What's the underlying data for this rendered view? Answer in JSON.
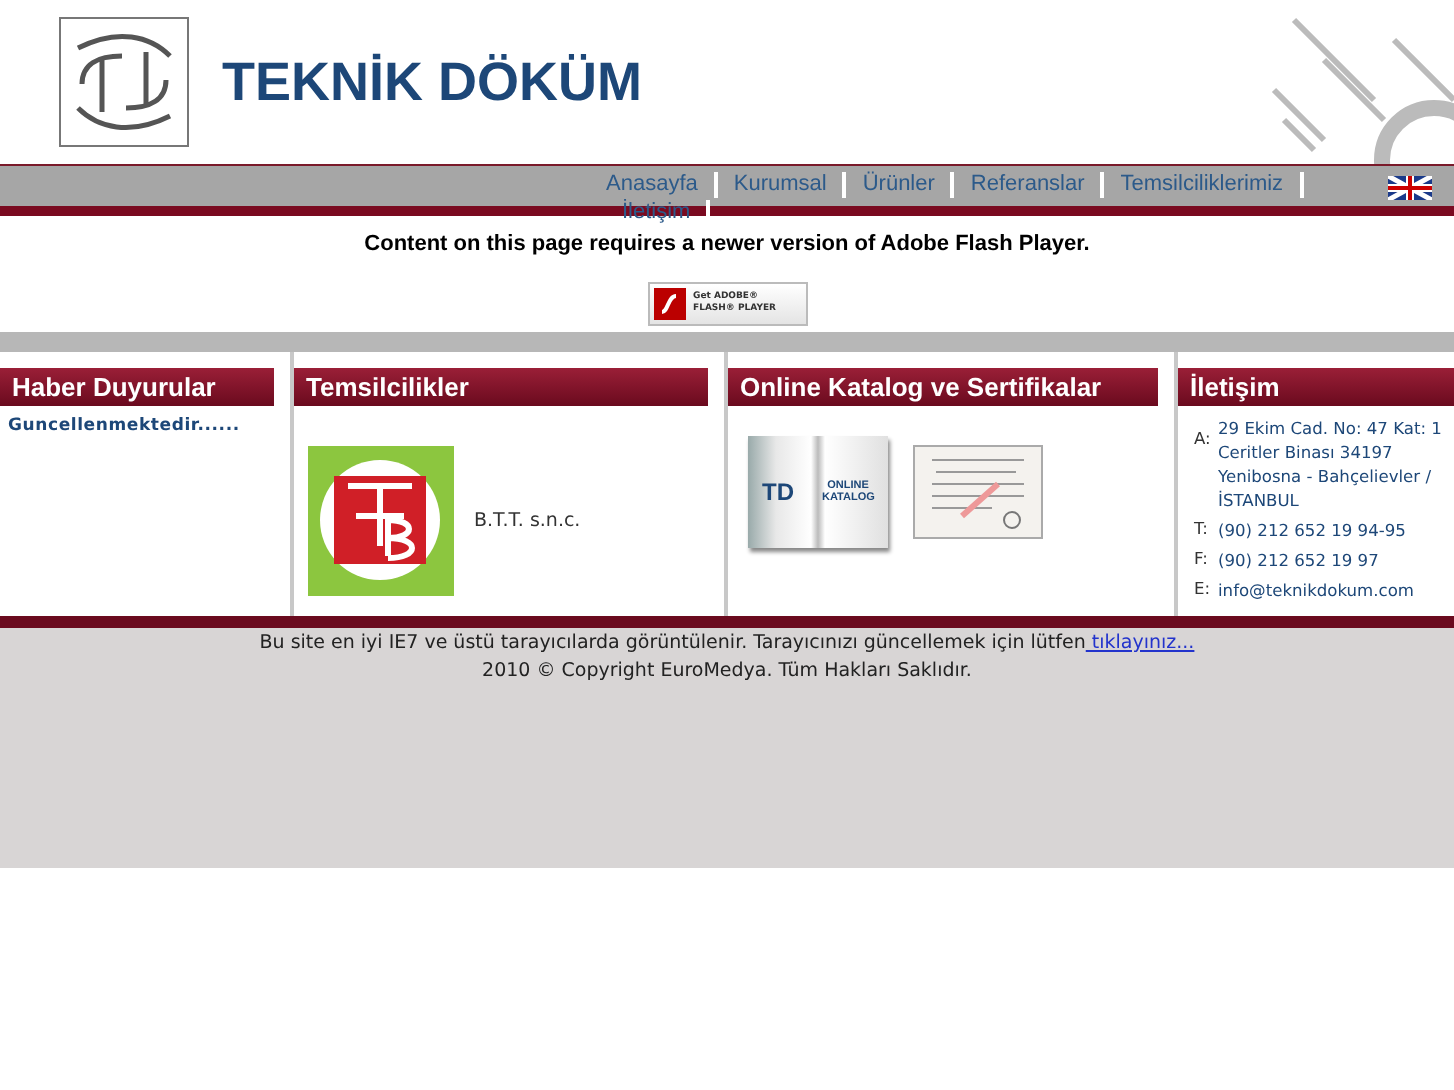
{
  "header": {
    "brand": "TEKNİK DÖKÜM"
  },
  "nav": {
    "items": [
      {
        "label": "Anasayfa"
      },
      {
        "label": "Kurumsal"
      },
      {
        "label": "Ürünler"
      },
      {
        "label": "Referanslar"
      },
      {
        "label": "Temsilciliklerimiz"
      },
      {
        "label": "İletişim"
      }
    ]
  },
  "flash": {
    "message": "Content on this page requires a newer version of Adobe Flash Player.",
    "badge_top": "Get ADOBE®",
    "badge_bottom": "FLASH® PLAYER"
  },
  "columns": [
    {
      "kind": "news",
      "title": "Haber Duyurular",
      "text": "Guncellenmektedir......"
    },
    {
      "kind": "reps",
      "title": "Temsilcilikler",
      "rep": "B.T.T. s.n.c."
    },
    {
      "kind": "catalog",
      "title": "Online Katalog ve Sertifikalar",
      "book_left": "TD",
      "book_right": "ONLINE KATALOG"
    },
    {
      "kind": "contact",
      "title": "İletişim",
      "rows": [
        {
          "label": "A:",
          "value": "29 Ekim Cad. No: 47 Kat: 1 Ceritler Binası 34197 Yenibosna - Bahçelievler / İSTANBUL"
        },
        {
          "label": "T:",
          "value": "(90) 212 652 19 94-95"
        },
        {
          "label": "F:",
          "value": "(90) 212 652 19 97"
        },
        {
          "label": "E:",
          "value": "info@teknikdokum.com"
        }
      ]
    }
  ],
  "footer": {
    "notice": "Bu site en iyi IE7 ve üstü tarayıcılarda görüntülenir. Tarayıcınızı güncellemek için lütfen",
    "link": " tıklayınız...",
    "copyright": "2010 © Copyright EuroMedya. Tüm Hakları Saklıdır."
  }
}
